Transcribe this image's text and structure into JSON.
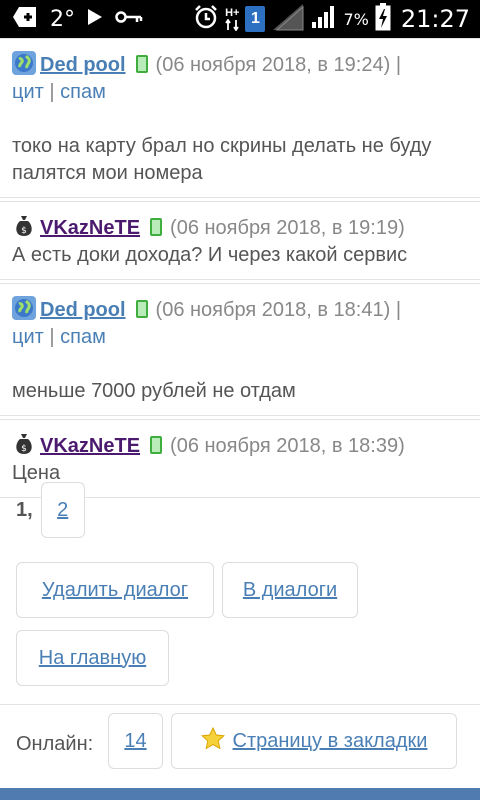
{
  "status_bar": {
    "temperature": "2°",
    "network_type": "H+",
    "sim_slot": "1",
    "battery_percent": "7%",
    "time": "21:27"
  },
  "messages": [
    {
      "nick": "Ded pool",
      "date": "(06 ноября 2018, в 19:24)",
      "sep1": "|",
      "quote_label": "цит",
      "sep2": "|",
      "spam_label": "спам",
      "text": "токо на карту брал но скрины делать не буду палятся мои номера"
    },
    {
      "nick": "VKazNeTE",
      "date": "(06 ноября 2018, в 19:19)",
      "text": "А есть доки дохода? И через какой сервис"
    },
    {
      "nick": "Ded pool",
      "date": "(06 ноября 2018, в 18:41)",
      "sep1": "|",
      "quote_label": "цит",
      "sep2": "|",
      "spam_label": "спам",
      "text": "меньше 7000 рублей не отдам"
    },
    {
      "nick": "VKazNeTE",
      "date": "(06 ноября 2018, в 18:39)",
      "text": "Цена"
    }
  ],
  "pagination": {
    "current": "1,",
    "next": "2"
  },
  "actions": {
    "delete_dialog": "Удалить диалог",
    "to_dialogs": "В диалоги",
    "home": "На главную"
  },
  "footer": {
    "online_label": "Онлайн:",
    "online_count": "14",
    "bookmark_label": "Страницу в закладки"
  },
  "colors": {
    "link": "#4a7fb5",
    "nick_blue": "#4a7fb5",
    "nick_purple": "#4b1a6e",
    "bottom_bar": "#4f7bb0"
  }
}
